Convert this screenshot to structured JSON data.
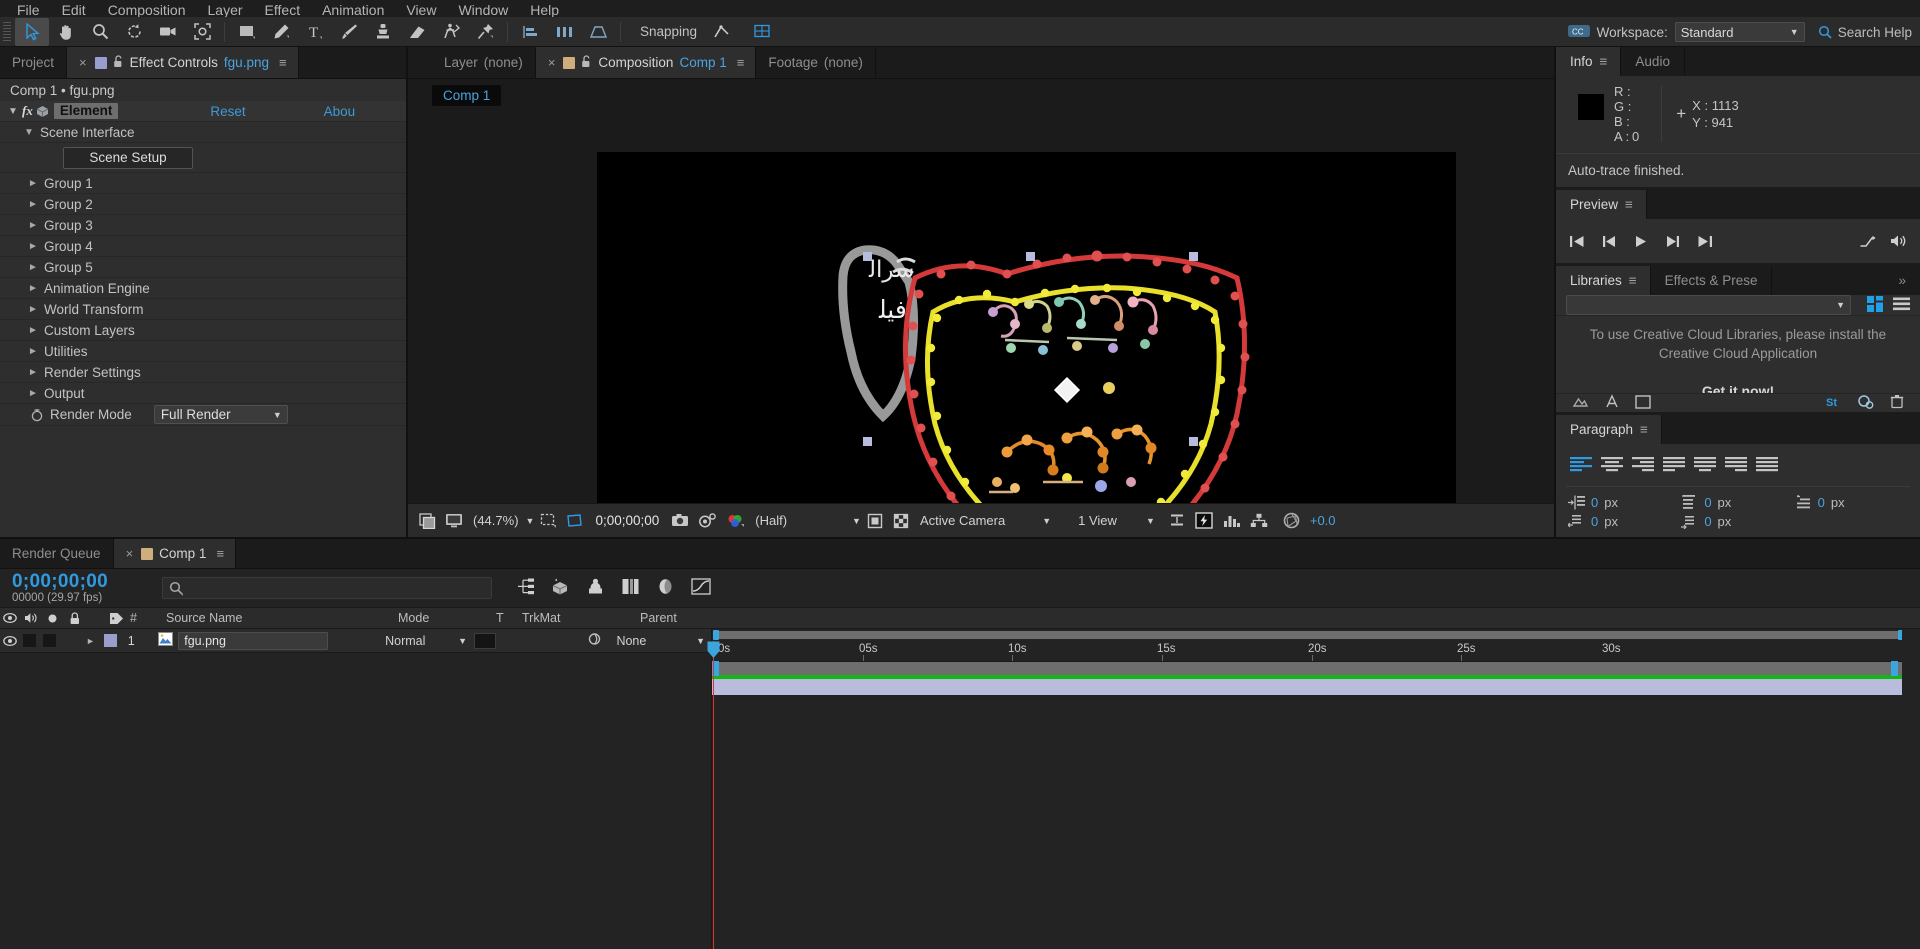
{
  "menubar": {
    "items": [
      "File",
      "Edit",
      "Composition",
      "Layer",
      "Effect",
      "Animation",
      "View",
      "Window",
      "Help"
    ]
  },
  "toolbar": {
    "snapping_label": "Snapping",
    "workspace_label": "Workspace:",
    "workspace_value": "Standard",
    "search_help": "Search Help"
  },
  "effect_controls": {
    "tabs": [
      {
        "label": "Project",
        "active": false
      },
      {
        "label": "Effect Controls",
        "suffix": "fgu.png",
        "active": true
      }
    ],
    "subtitle": "Comp 1 • fgu.png",
    "effect_name": "Element",
    "reset_label": "Reset",
    "about_label": "Abou",
    "scene_interface": "Scene Interface",
    "scene_setup_button": "Scene Setup",
    "groups": [
      "Group 1",
      "Group 2",
      "Group 3",
      "Group 4",
      "Group 5",
      "Animation Engine",
      "World Transform",
      "Custom Layers",
      "Utilities",
      "Render Settings",
      "Output"
    ],
    "render_mode_label": "Render Mode",
    "render_mode_value": "Full Render"
  },
  "viewer": {
    "tabs": [
      {
        "label": "Layer",
        "sub": "(none)",
        "active": false
      },
      {
        "label": "Composition",
        "sub": "Comp 1",
        "active": true
      },
      {
        "label": "Footage",
        "sub": "(none)",
        "active": false
      }
    ],
    "comp_chip": "Comp 1",
    "toolbar": {
      "magnification": "(44.7%)",
      "timecode": "0;00;00;00",
      "resolution": "(Half)",
      "camera": "Active Camera",
      "views": "1 View",
      "exposure": "+0.0"
    }
  },
  "info": {
    "tabs": [
      {
        "label": "Info",
        "active": true
      },
      {
        "label": "Audio",
        "active": false
      }
    ],
    "channels": [
      {
        "key": "R :",
        "value": ""
      },
      {
        "key": "G :",
        "value": ""
      },
      {
        "key": "B :",
        "value": ""
      },
      {
        "key": "A :",
        "value": "0"
      }
    ],
    "x_label": "X :",
    "x_value": "1113",
    "y_label": "Y :",
    "y_value": "941",
    "message": "Auto-trace finished."
  },
  "preview": {
    "title": "Preview"
  },
  "libraries": {
    "tabs": [
      {
        "label": "Libraries",
        "active": true
      },
      {
        "label": "Effects & Prese",
        "active": false
      }
    ],
    "message": "To use Creative Cloud Libraries, please install the Creative Cloud Application",
    "link": "Get it now!"
  },
  "paragraph": {
    "title": "Paragraph",
    "fields": [
      {
        "value": "0",
        "unit": "px",
        "name": "indent-left"
      },
      {
        "value": "0",
        "unit": "px",
        "name": "indent-right"
      },
      {
        "value": "0",
        "unit": "px",
        "name": "indent-first-line"
      },
      {
        "value": "0",
        "unit": "px",
        "name": "space-before"
      },
      {
        "value": "0",
        "unit": "px",
        "name": "space-after"
      }
    ]
  },
  "timeline": {
    "tabs": [
      {
        "label": "Render Queue",
        "active": false
      },
      {
        "label": "Comp 1",
        "active": true
      }
    ],
    "timecode": "0;00;00;00",
    "frames": "00000 (29.97 fps)",
    "search_placeholder": "",
    "columns": [
      "#",
      "Source Name",
      "Mode",
      "T",
      "TrkMat",
      "Parent"
    ],
    "layers": [
      {
        "index": "1",
        "source_name": "fgu.png",
        "mode": "Normal",
        "trkmat": "",
        "parent": "None"
      }
    ],
    "ruler_labels": [
      "0s",
      "05s",
      "10s",
      "15s",
      "20s",
      "25s",
      "30s"
    ]
  },
  "colors": {
    "accent_blue": "#2f9ae0",
    "link_blue": "#4aa3e0",
    "panel_bg": "#2e2e2e",
    "chrome_bg": "#1b1b1b",
    "layer_bar": "#b9bcdc",
    "work_green": "#15b515",
    "cti_red": "#e03030"
  }
}
